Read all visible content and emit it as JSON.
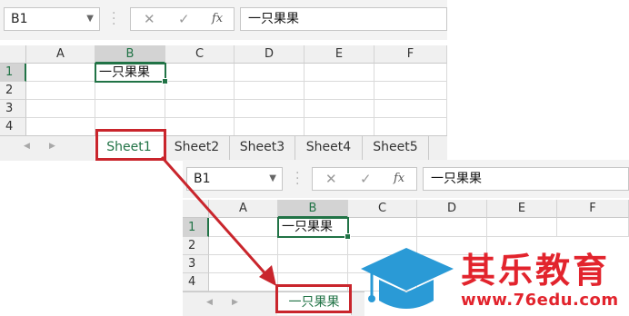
{
  "top_window": {
    "name_box": "B1",
    "formula_icons": {
      "cancel": "✕",
      "enter": "✓",
      "fx": "fx"
    },
    "formula_value": "一只果果",
    "columns": [
      "A",
      "B",
      "C",
      "D",
      "E",
      "F"
    ],
    "rows": [
      "1",
      "2",
      "3",
      "4"
    ],
    "active_cell": {
      "ref": "B1",
      "value": "一只果果"
    },
    "sheet_tabs": [
      "Sheet1",
      "Sheet2",
      "Sheet3",
      "Sheet4",
      "Sheet5"
    ],
    "active_tab": "Sheet1"
  },
  "bottom_window": {
    "name_box": "B1",
    "formula_icons": {
      "cancel": "✕",
      "enter": "✓",
      "fx": "fx"
    },
    "formula_value": "一只果果",
    "columns": [
      "A",
      "B",
      "C",
      "D",
      "E",
      "F"
    ],
    "rows": [
      "1",
      "2",
      "3",
      "4"
    ],
    "active_cell": {
      "ref": "B1",
      "value": "一只果果"
    },
    "active_tab": "一只果果"
  },
  "annotation": {
    "color": "#c9252c"
  },
  "logo": {
    "title": "其乐教育",
    "url": "www.76edu.com",
    "color": "#e2242d",
    "cap_color": "#2a9ad6"
  }
}
